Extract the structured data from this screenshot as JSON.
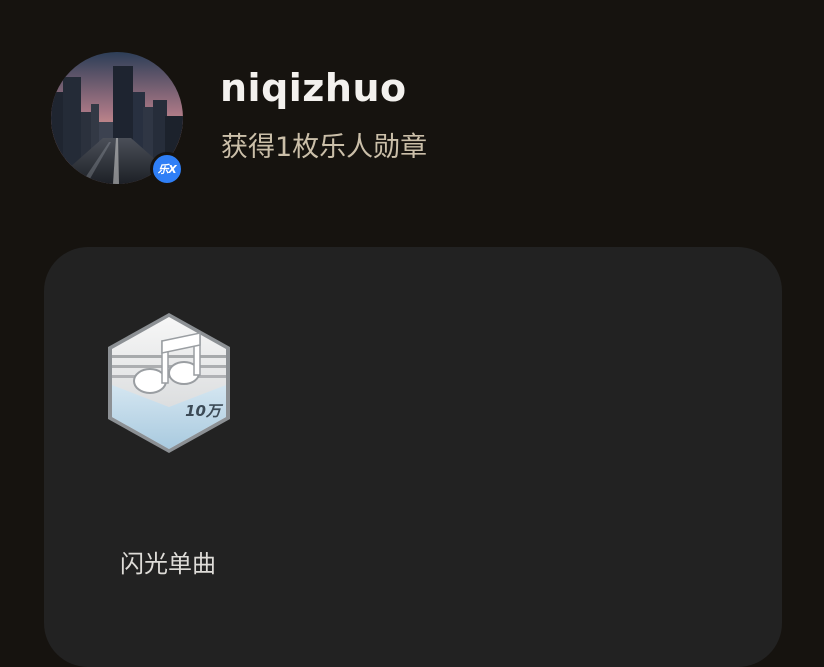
{
  "profile": {
    "username": "niqizhuo",
    "badge_summary": "获得1枚乐人勋章",
    "avatar": "city-street-sunset-photo",
    "verified_badge_text": "乐X",
    "verified_badge_color": "#2f7ff6"
  },
  "badges": [
    {
      "name": "闪光单曲",
      "icon": "music-note-hexagon-badge-icon",
      "tier_label": "10万"
    }
  ],
  "colors": {
    "background": "#16130f",
    "panel": "#222222",
    "username": "#f3f1ee",
    "summary": "#cbbfa9"
  }
}
